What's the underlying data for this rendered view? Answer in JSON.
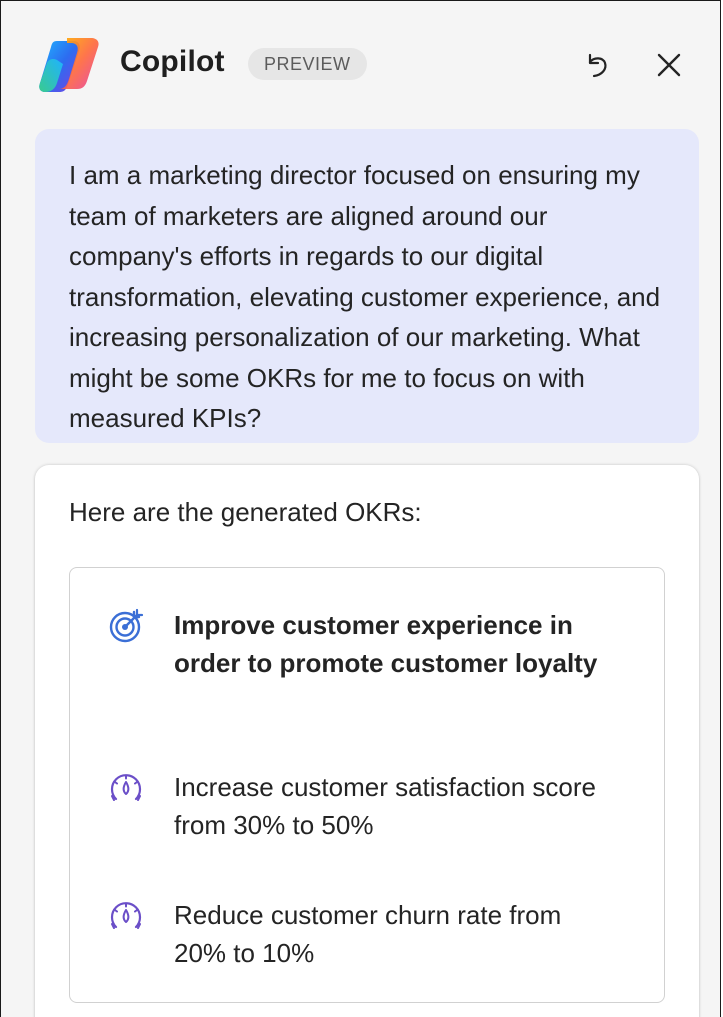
{
  "header": {
    "app_name": "Copilot",
    "badge": "PREVIEW",
    "icons": {
      "logo": "copilot-logo",
      "undo": "undo-icon",
      "close": "close-icon"
    }
  },
  "prompt": {
    "text": "I am a marketing director focused on ensuring my team of marketers are aligned around our company's efforts in regards to our digital transformation, elevating customer experience, and increasing personalization of our marketing. What might be some OKRs for me to focus on with measured KPIs?"
  },
  "response": {
    "intro": "Here are the generated OKRs:",
    "okrs": {
      "objective": {
        "icon": "target-icon",
        "text": "Improve customer experience in order to promote customer loyalty"
      },
      "key_results": [
        {
          "icon": "gauge-icon",
          "text": "Increase customer satisfaction score from 30% to 50%"
        },
        {
          "icon": "gauge-icon",
          "text": "Reduce customer churn rate from 20% to 10%"
        }
      ]
    }
  },
  "colors": {
    "prompt_bg": "#e5e8fb",
    "panel_bg": "#f5f5f5",
    "objective_icon": "#3b6fd6",
    "kr_icon": "#6b4fc8"
  }
}
